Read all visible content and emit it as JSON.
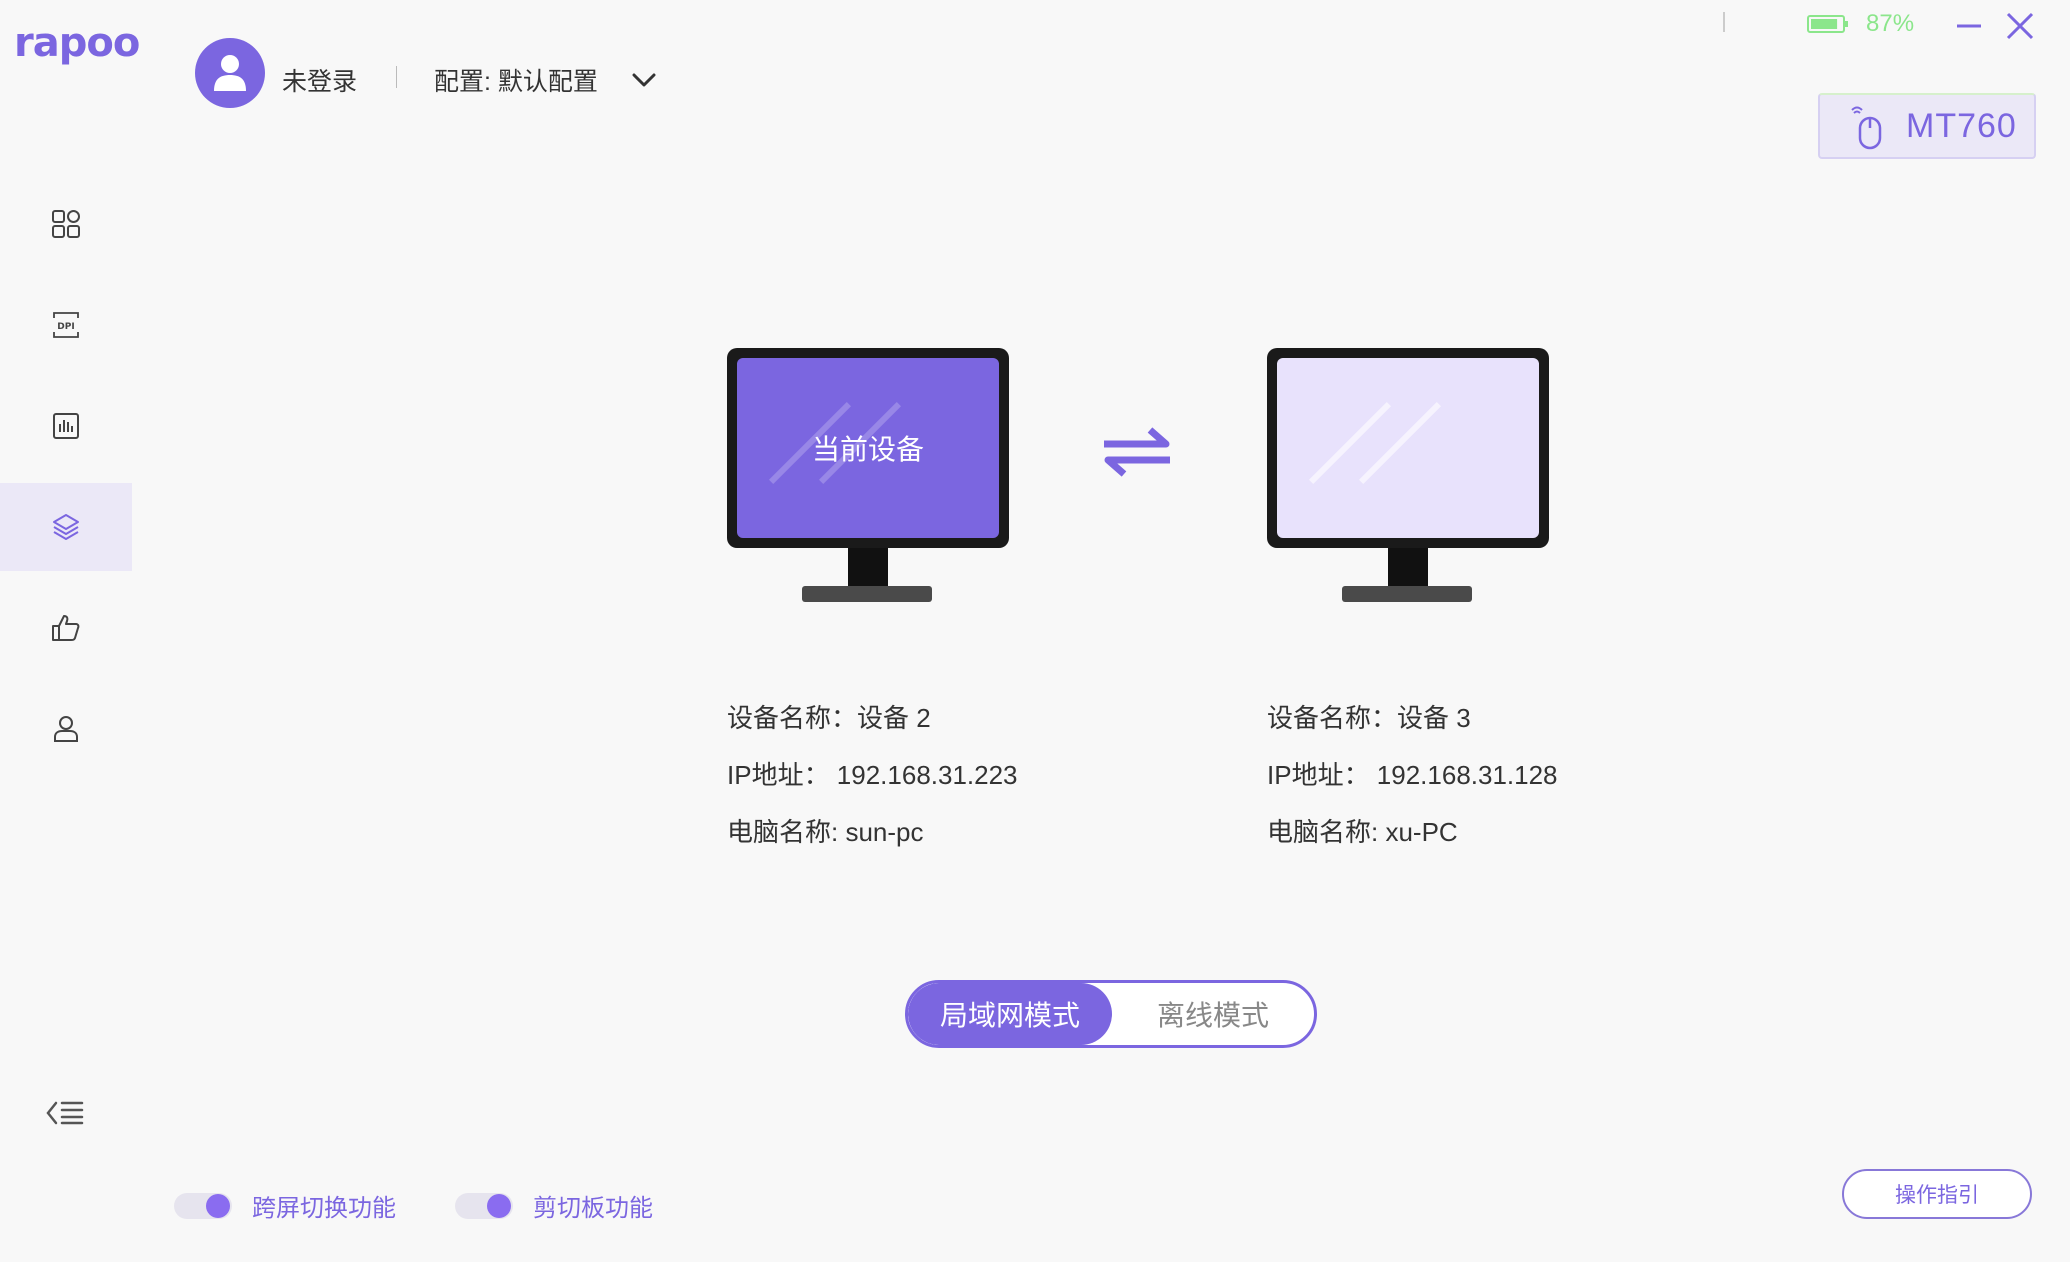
{
  "app": {
    "logo_text": "rapoo"
  },
  "header": {
    "login_status": "未登录",
    "config_label": "配置: 默认配置"
  },
  "status": {
    "battery_percent": "87%",
    "battery_level": 0.87,
    "battery_color": "#8be68b"
  },
  "device": {
    "name": "MT760"
  },
  "sidebar": {
    "items": [
      {
        "icon": "grid-icon",
        "active": false
      },
      {
        "icon": "dpi-icon",
        "active": false
      },
      {
        "icon": "bar-chart-icon",
        "active": false
      },
      {
        "icon": "layers-icon",
        "active": true
      },
      {
        "icon": "thumbs-up-icon",
        "active": false
      },
      {
        "icon": "user-icon",
        "active": false
      }
    ],
    "collapse_icon": "collapse-menu-icon"
  },
  "devices": {
    "current": {
      "screen_label": "当前设备",
      "name_line": "设备名称：设备 2",
      "ip_line": "IP地址：  192.168.31.223",
      "pc_line": "电脑名称: sun-pc"
    },
    "remote": {
      "name_line": "设备名称：设备 3",
      "ip_line": "IP地址：  192.168.31.128",
      "pc_line": "电脑名称: xu-PC"
    }
  },
  "mode": {
    "lan_label": "局域网模式",
    "offline_label": "离线模式",
    "selected": "lan"
  },
  "footer": {
    "cross_screen_label": "跨屏切换功能",
    "cross_screen_on": true,
    "clipboard_label": "剪切板功能",
    "clipboard_on": true,
    "guide_label": "操作指引"
  },
  "colors": {
    "accent": "#7b66e0",
    "current_screen": "#7b66e0",
    "remote_screen": "#e8e2fc",
    "active_nav_bg": "#ebe8f7"
  }
}
